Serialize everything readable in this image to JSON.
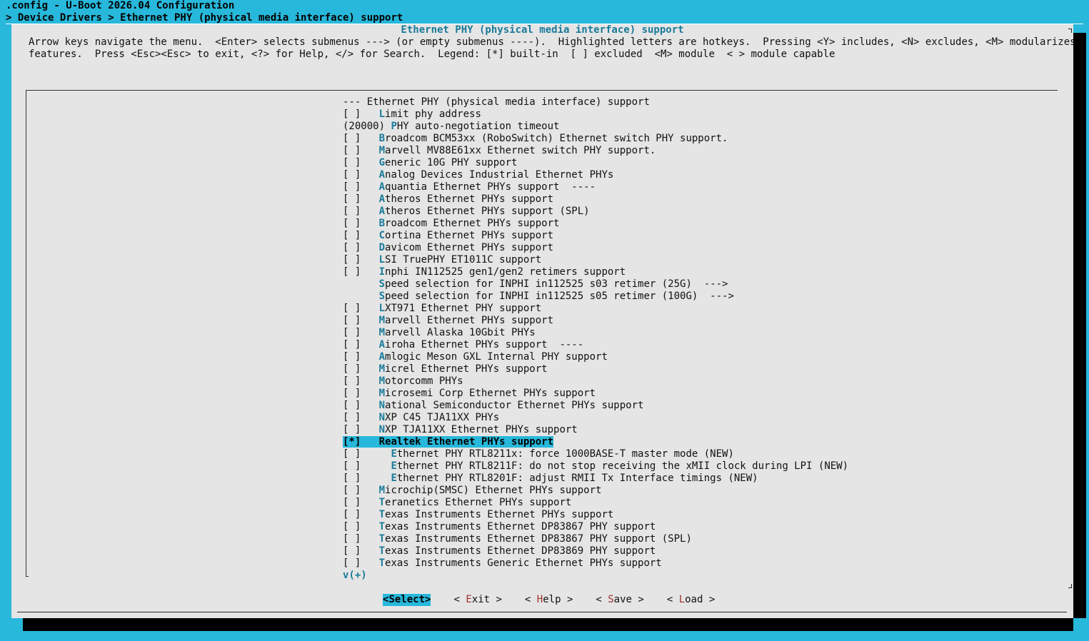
{
  "window": {
    "title": ".config - U-Boot 2026.04 Configuration",
    "breadcrumb": "> Device Drivers > Ethernet PHY (physical media interface) support"
  },
  "dialog": {
    "title": "Ethernet PHY (physical media interface) support",
    "help_line_1": "Arrow keys navigate the menu.  <Enter> selects submenus ---> (or empty submenus ----).  Highlighted letters are hotkeys.  Pressing <Y> includes, <N> excludes, <M> modularizes",
    "help_line_2": "features.  Press <Esc><Esc> to exit, <?> for Help, </> for Search.  Legend: [*] built-in  [ ] excluded  <M> module  < > module capable"
  },
  "menu": {
    "items": [
      {
        "prefix": "--- ",
        "hotkey": "",
        "label": "Ethernet PHY (physical media interface) support"
      },
      {
        "prefix": "[ ]   ",
        "hotkey": "L",
        "label": "imit phy address"
      },
      {
        "prefix": "(20000) ",
        "hotkey": "P",
        "label": "HY auto-negotiation timeout"
      },
      {
        "prefix": "[ ]   ",
        "hotkey": "B",
        "label": "roadcom BCM53xx (RoboSwitch) Ethernet switch PHY support."
      },
      {
        "prefix": "[ ]   ",
        "hotkey": "M",
        "label": "arvell MV88E61xx Ethernet switch PHY support."
      },
      {
        "prefix": "[ ]   ",
        "hotkey": "G",
        "label": "eneric 10G PHY support"
      },
      {
        "prefix": "[ ]   ",
        "hotkey": "A",
        "label": "nalog Devices Industrial Ethernet PHYs"
      },
      {
        "prefix": "[ ]   ",
        "hotkey": "A",
        "label": "quantia Ethernet PHYs support  ----"
      },
      {
        "prefix": "[ ]   ",
        "hotkey": "A",
        "label": "theros Ethernet PHYs support"
      },
      {
        "prefix": "[ ]   ",
        "hotkey": "A",
        "label": "theros Ethernet PHYs support (SPL)"
      },
      {
        "prefix": "[ ]   ",
        "hotkey": "B",
        "label": "roadcom Ethernet PHYs support"
      },
      {
        "prefix": "[ ]   ",
        "hotkey": "C",
        "label": "ortina Ethernet PHYs support"
      },
      {
        "prefix": "[ ]   ",
        "hotkey": "D",
        "label": "avicom Ethernet PHYs support"
      },
      {
        "prefix": "[ ]   ",
        "hotkey": "L",
        "label": "SI TruePHY ET1011C support"
      },
      {
        "prefix": "[ ]   ",
        "hotkey": "I",
        "label": "nphi IN112525 gen1/gen2 retimers support"
      },
      {
        "prefix": "      ",
        "hotkey": "S",
        "label": "peed selection for INPHI in112525 s03 retimer (25G)  --->"
      },
      {
        "prefix": "      ",
        "hotkey": "S",
        "label": "peed selection for INPHI in112525 s05 retimer (100G)  --->"
      },
      {
        "prefix": "[ ]   ",
        "hotkey": "L",
        "label": "XT971 Ethernet PHY support"
      },
      {
        "prefix": "[ ]   ",
        "hotkey": "M",
        "label": "arvell Ethernet PHYs support"
      },
      {
        "prefix": "[ ]   ",
        "hotkey": "M",
        "label": "arvell Alaska 10Gbit PHYs"
      },
      {
        "prefix": "[ ]   ",
        "hotkey": "A",
        "label": "iroha Ethernet PHYs support  ----"
      },
      {
        "prefix": "[ ]   ",
        "hotkey": "A",
        "label": "mlogic Meson GXL Internal PHY support"
      },
      {
        "prefix": "[ ]   ",
        "hotkey": "M",
        "label": "icrel Ethernet PHYs support"
      },
      {
        "prefix": "[ ]   ",
        "hotkey": "M",
        "label": "otorcomm PHYs"
      },
      {
        "prefix": "[ ]   ",
        "hotkey": "M",
        "label": "icrosemi Corp Ethernet PHYs support"
      },
      {
        "prefix": "[ ]   ",
        "hotkey": "N",
        "label": "ational Semiconductor Ethernet PHYs support"
      },
      {
        "prefix": "[ ]   ",
        "hotkey": "N",
        "label": "XP C45 TJA11XX PHYs"
      },
      {
        "prefix": "[ ]   ",
        "hotkey": "N",
        "label": "XP TJA11XX Ethernet PHYs support"
      },
      {
        "prefix": "[*]   ",
        "hotkey": "R",
        "label": "ealtek Ethernet PHYs support",
        "selected": true
      },
      {
        "prefix": "[ ]     ",
        "hotkey": "E",
        "label": "thernet PHY RTL8211x: force 1000BASE-T master mode (NEW)"
      },
      {
        "prefix": "[ ]     ",
        "hotkey": "E",
        "label": "thernet PHY RTL8211F: do not stop receiving the xMII clock during LPI (NEW)"
      },
      {
        "prefix": "[ ]     ",
        "hotkey": "E",
        "label": "thernet PHY RTL8201F: adjust RMII Tx Interface timings (NEW)"
      },
      {
        "prefix": "[ ]   ",
        "hotkey": "M",
        "label": "icrochip(SMSC) Ethernet PHYs support"
      },
      {
        "prefix": "[ ]   ",
        "hotkey": "T",
        "label": "eranetics Ethernet PHYs support"
      },
      {
        "prefix": "[ ]   ",
        "hotkey": "T",
        "label": "exas Instruments Ethernet PHYs support"
      },
      {
        "prefix": "[ ]   ",
        "hotkey": "T",
        "label": "exas Instruments Ethernet DP83867 PHY support"
      },
      {
        "prefix": "[ ]   ",
        "hotkey": "T",
        "label": "exas Instruments Ethernet DP83867 PHY support (SPL)"
      },
      {
        "prefix": "[ ]   ",
        "hotkey": "T",
        "label": "exas Instruments Ethernet DP83869 PHY support"
      },
      {
        "prefix": "[ ]   ",
        "hotkey": "T",
        "label": "exas Instruments Generic Ethernet PHYs support"
      }
    ],
    "more_indicator": "v(+)"
  },
  "buttons": [
    {
      "pre": "<",
      "hotkey": "S",
      "label": "elect",
      "post": ">",
      "active": true
    },
    {
      "pre": "< ",
      "hotkey": "E",
      "label": "xit",
      "post": " >",
      "active": false
    },
    {
      "pre": "< ",
      "hotkey": "H",
      "label": "elp",
      "post": " >",
      "active": false
    },
    {
      "pre": "< ",
      "hotkey": "S",
      "label": "ave",
      "post": " >",
      "active": false
    },
    {
      "pre": "< ",
      "hotkey": "L",
      "label": "oad",
      "post": " >",
      "active": false
    }
  ],
  "colors": {
    "background": "#27b8db",
    "dialog": "#e5e5e5",
    "hotkey": "#1a7a99",
    "button_hotkey": "#a0302e",
    "selection": "#27b8db"
  }
}
